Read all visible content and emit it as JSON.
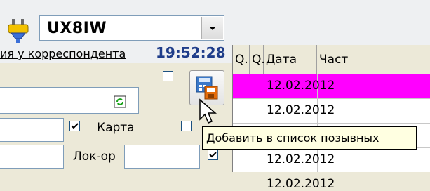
{
  "header": {
    "callsign": "UX8IW",
    "time_label": "ия у корреспондента",
    "time_value": "19:52:28"
  },
  "form": {
    "card_label": "Карта",
    "locator_label": "Лок-ор",
    "card_checked": true,
    "locator_checked": true
  },
  "grid": {
    "columns": [
      "Q.",
      "Q.",
      "Дата",
      "Част"
    ],
    "rows": [
      {
        "date": "12.02.2012",
        "highlighted": true
      },
      {
        "date": "12.02.2012",
        "highlighted": false
      },
      {
        "date": "",
        "highlighted": false
      },
      {
        "date": "12.02.2012",
        "highlighted": false
      },
      {
        "date": "12.02.2012",
        "highlighted": false
      }
    ]
  },
  "tooltip": {
    "text": "Добавить в список позывных"
  },
  "colors": {
    "highlight_row": "#ff00ff",
    "time_value": "#1f3d8a"
  }
}
